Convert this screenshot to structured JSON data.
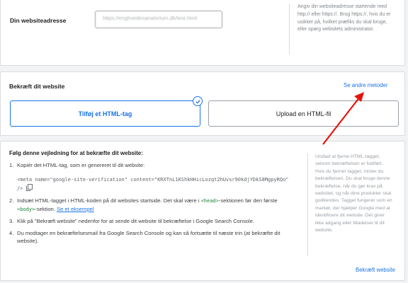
{
  "url_section": {
    "label": "Din websiteadresse",
    "input_value": "https://enghvedesanatorium.dk/test.html",
    "help": "Angiv din websiteadresse startende med http:// eller https://. Brug https://, hvis du er usikker på, hvilket præfiks du skal bruge, eller spørg websitets administrator."
  },
  "verify_section": {
    "title": "Bekræft dit website",
    "other_methods_link": "Se andre metoder",
    "method_selected": "Tilføj et HTML-tag",
    "method_other": "Upload en HTML-fil"
  },
  "guide": {
    "title": "Følg denne vejledning for at bekræfte dit website:",
    "step1_num": "1.",
    "step1_text": "Kopiér det HTML-tag, som er genereret til dit website:",
    "meta_tag": "<meta name=\"google-site-verification\" content=\"KRXTnL1KShkHHicLozqt2hUvsr90kdjYDkS8MgpyRQo\"",
    "meta_tag_end": "/>",
    "step2_num": "2.",
    "step2_text_a": "Indsæt HTML-tagget i HTML-koden på dit websites startside. Det skal være i ",
    "step2_head": "<head>",
    "step2_text_b": "-sektionen før den første ",
    "step2_body": "<body>",
    "step2_text_c": "-sektion. ",
    "step2_link": "Se et eksempel",
    "step3_num": "3.",
    "step3_text": "Klik på \"Bekræft website\" nedenfor for at sende dit website til bekræftelse i Google Search Console.",
    "step4_num": "4.",
    "step4_text": "Du modtager en bekræftelsesmail fra Google Search Console og kan så fortsætte til næste trin (at bekræfte dit website).",
    "help": "Undlad at fjerne HTML-tagget, selvom bekræftelsen er fuldført. Hvis du fjerner tagget, mister du bekræftelsen. Du skal bruge denne bekræftelse, når du gør krav på websitet, og når dine produkter skal godkendes. Tagget fungerer som en markør, der hjælper Google med at identificere dit website. Det giver ikke adgang eller tilladelser til dit website.",
    "verify_button": "Bekræft website"
  },
  "colors": {
    "accent": "#1a73e8",
    "arrow": "#e8120c",
    "code_green": "#188038"
  }
}
